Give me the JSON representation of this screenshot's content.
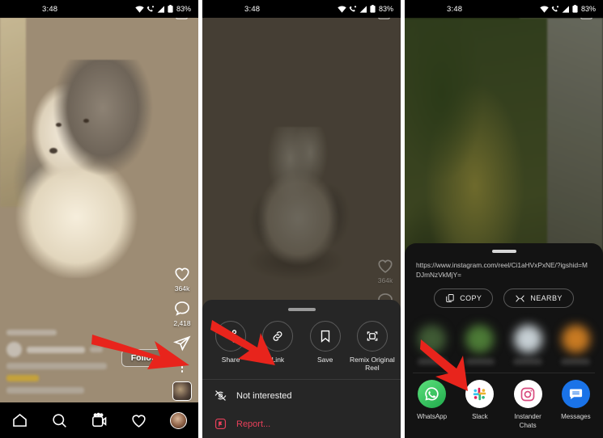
{
  "tutorial": {
    "panels": [
      {
        "id": "instagram-reel",
        "statusbar": {
          "time": "3:48",
          "battery": "83%",
          "icons": [
            "wifi-icon",
            "call-icon",
            "signal-icon",
            "battery-icon"
          ]
        },
        "camera_icon": "camera-icon",
        "rail": {
          "like": {
            "icon": "heart-icon",
            "count": "364k"
          },
          "comment": {
            "icon": "comment-icon",
            "count": "2,418"
          },
          "share": {
            "icon": "send-icon"
          },
          "more": {
            "icon": "more-options-icon"
          },
          "audio_thumb": "audio-thumbnail"
        },
        "follow_label": "Follow",
        "bottom_nav": [
          {
            "name": "home-icon",
            "label": "Home"
          },
          {
            "name": "search-icon",
            "label": "Search"
          },
          {
            "name": "reels-icon",
            "label": "Reels"
          },
          {
            "name": "heart-icon",
            "label": "Activity"
          },
          {
            "name": "profile-avatar",
            "label": "Profile"
          }
        ]
      },
      {
        "id": "reel-options-sheet",
        "statusbar": {
          "time": "3:48",
          "battery": "83%"
        },
        "camera_icon": "camera-icon",
        "rail": {
          "like": {
            "count": "364k"
          }
        },
        "actions": [
          {
            "icon": "share-icon",
            "label": "Share"
          },
          {
            "icon": "link-icon",
            "label": "Link"
          },
          {
            "icon": "bookmark-icon",
            "label": "Save"
          },
          {
            "icon": "remix-icon",
            "label": "Remix Original Reel"
          }
        ],
        "rows": [
          {
            "icon": "eye-off-icon",
            "label": "Not interested",
            "style": "default"
          },
          {
            "icon": "report-icon",
            "label": "Report...",
            "style": "danger"
          }
        ]
      },
      {
        "id": "android-share-sheet",
        "statusbar": {
          "time": "3:48",
          "battery": "83%"
        },
        "camera_icon": "camera-icon",
        "url": "https://www.instagram.com/reel/Ci1aHVxPxNE/?igshid=MDJmNzVkMjY=",
        "buttons": [
          {
            "icon": "copy-icon",
            "label": "COPY"
          },
          {
            "icon": "nearby-share-icon",
            "label": "NEARBY"
          }
        ],
        "apps": [
          {
            "icon": "whatsapp-icon",
            "label": "WhatsApp"
          },
          {
            "icon": "slack-icon",
            "label": "Slack"
          },
          {
            "icon": "instander-icon",
            "label": "Instander Chats"
          },
          {
            "icon": "messages-icon",
            "label": "Messages"
          }
        ]
      }
    ],
    "annotations": [
      {
        "name": "arrow-to-more-options",
        "panel": 1,
        "color": "#e8241c"
      },
      {
        "name": "arrow-to-share-action",
        "panel": 2,
        "color": "#e8241c"
      },
      {
        "name": "arrow-to-whatsapp",
        "panel": 3,
        "color": "#e8241c"
      }
    ],
    "colors": {
      "accent_red": "#e8241c",
      "sheet_bg": "#262626",
      "share_sheet_bg": "#131313",
      "danger": "#e8405a"
    }
  }
}
